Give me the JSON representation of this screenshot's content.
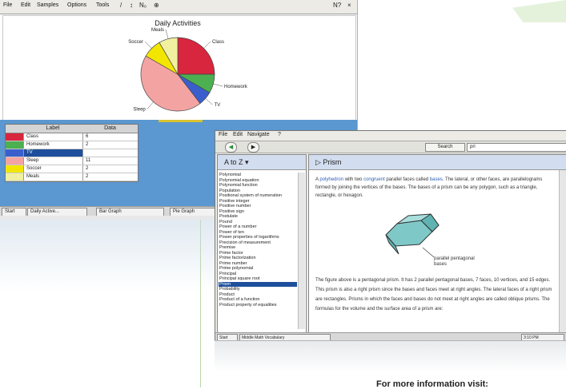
{
  "chart_app": {
    "menu": [
      "File",
      "Edit",
      "Samples",
      "Options",
      "Tools"
    ],
    "toolbar_glyphs": [
      "/",
      "↕",
      "N₀",
      "⊕"
    ],
    "help_glyph": "N?",
    "close_glyph": "×",
    "table": {
      "headers": [
        "Label",
        "Data"
      ],
      "rows": [
        {
          "label": "Class",
          "value": "6",
          "color": "#d7263d"
        },
        {
          "label": "Homework",
          "value": "2",
          "color": "#4caf50"
        },
        {
          "label": "TV",
          "value": "",
          "color": "#3a5fcd"
        },
        {
          "label": "Sleep",
          "value": "11",
          "color": "#f4a3a3"
        },
        {
          "label": "Soccer",
          "value": "2",
          "color": "#f2e600"
        },
        {
          "label": "Meals",
          "value": "2",
          "color": "#f0f0a0"
        }
      ]
    },
    "taskbar": [
      "Start",
      "Daily Active...",
      "Bar Graph",
      "Pie Graph"
    ]
  },
  "chart_data": {
    "type": "pie",
    "title": "Daily Activities",
    "categories": [
      "Class",
      "Homework",
      "TV",
      "Sleep",
      "Soccer",
      "Meals"
    ],
    "values": [
      6,
      2,
      1.5,
      10.5,
      2,
      2
    ],
    "colors": [
      "#d7263d",
      "#4caf50",
      "#3a5fcd",
      "#f4a3a3",
      "#f2e600",
      "#f0f0a0"
    ]
  },
  "glossary_app": {
    "menu": [
      "File",
      "Edit",
      "Navigate",
      "?"
    ],
    "search_label": "Search",
    "search_value": "pri",
    "index_title": "A to Z ▾",
    "entry_title": "Prism",
    "terms": [
      "Polynomial",
      "Polynomial equation",
      "Polynomial function",
      "Population",
      "Positional system of numeration",
      "Positive integer",
      "Positive number",
      "Positive sign",
      "Postulate",
      "Pound",
      "Power of a number",
      "Power of ten",
      "Power properties of logarithms",
      "Precision of measurement",
      "Premise",
      "Prime factor",
      "Prime factorization",
      "Prime number",
      "Prime polynomial",
      "Principal",
      "Principal square root",
      "Prism",
      "Probability",
      "Product",
      "Product of a function",
      "Product property of equalities"
    ],
    "selected_term": "Prism",
    "entry_para1_pre": "A ",
    "entry_para1_link1": "polyhedron",
    "entry_para1_mid1": " with two ",
    "entry_para1_link2": "congruent",
    "entry_para1_mid2": " parallel faces called ",
    "entry_para1_link3": "bases",
    "entry_para1_post": ". The lateral, or other faces, are parallelograms formed by joining the vertices of the bases. The bases of a prism can be any polygon, such as a triangle, rectangle, or hexagon.",
    "caption": "parallel pentagonal bases",
    "entry_para2": "The figure above is a pentagonal prism. It has 2 parallel pentagonal bases, 7 faces, 10 vertices, and 15 edges. This prism is also a right prism since the bases and faces meet at right angles. The lateral faces of a right prism are rectangles. Prisms in which the faces and bases do not meet at right angles are called oblique prisms. The formulas for the volume and the surface area of a prism are:",
    "taskbar": [
      "Start",
      "Middle Math Vocabulary",
      "3:10 PM"
    ]
  },
  "footer": "For more information visit:"
}
